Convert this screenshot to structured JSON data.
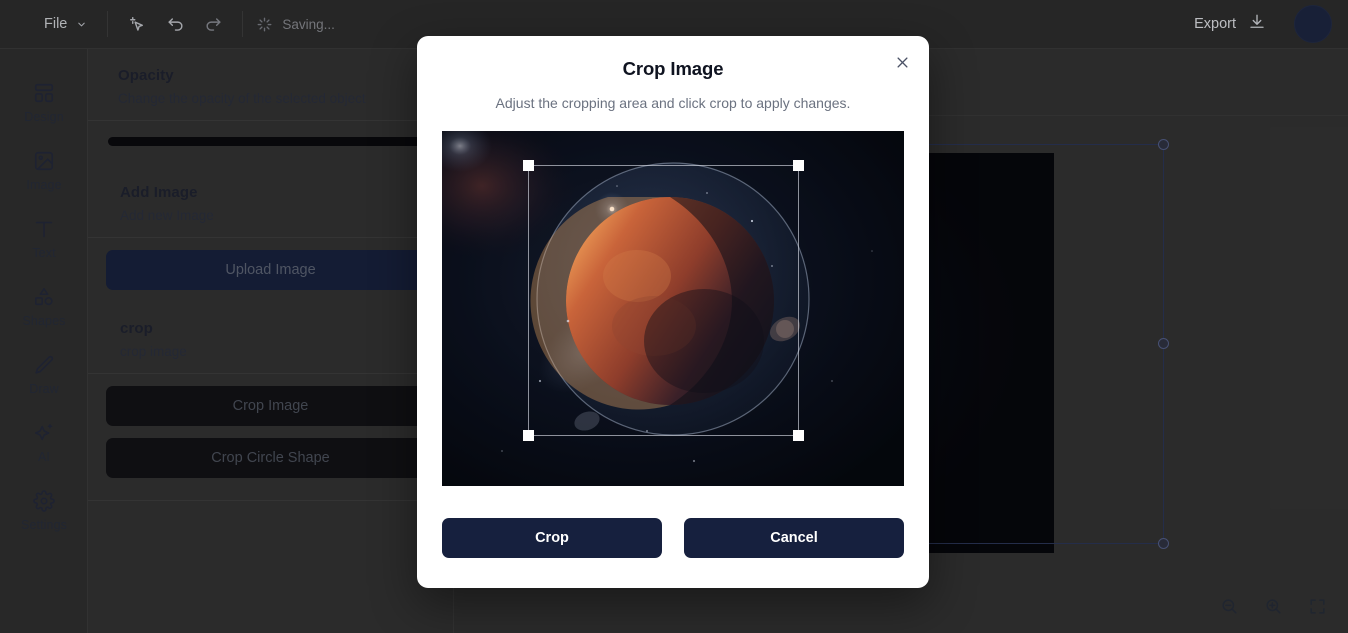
{
  "topbar": {
    "file_label": "File",
    "file_chevron_icon": "chevron-down-icon",
    "magic_select_icon": "magic-cursor-icon",
    "undo_icon": "undo-icon",
    "redo_icon": "redo-icon",
    "spinner_icon": "loading-spinner-icon",
    "status_text": "Saving...",
    "export_label": "Export",
    "export_icon": "download-icon",
    "avatar_icon": "user-avatar"
  },
  "rail": {
    "items": [
      {
        "label": "Design",
        "icon": "layout-icon"
      },
      {
        "label": "Image",
        "icon": "image-icon"
      },
      {
        "label": "Text",
        "icon": "text-t-icon"
      },
      {
        "label": "Shapes",
        "icon": "shapes-icon"
      },
      {
        "label": "Draw",
        "icon": "pencil-icon"
      },
      {
        "label": "AI",
        "icon": "sparkle-icon"
      },
      {
        "label": "Settings",
        "icon": "gear-icon"
      }
    ]
  },
  "panel": {
    "opacity": {
      "title": "Opacity",
      "subtitle": "Change the opacity of the selected object",
      "slider_value": "100"
    },
    "add_image": {
      "title": "Add Image",
      "subtitle": "Add new Image",
      "upload_label": "Upload Image"
    },
    "crop": {
      "title": "crop",
      "subtitle": "crop image",
      "crop_image_label": "Crop Image",
      "crop_circle_label": "Crop Circle Shape"
    }
  },
  "canvas": {
    "zoom_out_icon": "zoom-out-icon",
    "zoom_in_icon": "zoom-in-icon",
    "fit_screen_icon": "fit-to-screen-icon"
  },
  "modal": {
    "title": "Crop Image",
    "subtitle": "Adjust the cropping area and click crop to apply changes.",
    "close_icon": "close-icon",
    "crop_label": "Crop",
    "cancel_label": "Cancel",
    "preview_alt": "space-planet-image"
  },
  "colors": {
    "app_bg": "#2f2f2f",
    "panel_bg": "#333333",
    "topbar_bg": "#2c2c2c",
    "accent_navy": "#16203e",
    "button_dark": "#101014",
    "modal_bg": "#ffffff",
    "selection_stroke": "#55608a"
  }
}
